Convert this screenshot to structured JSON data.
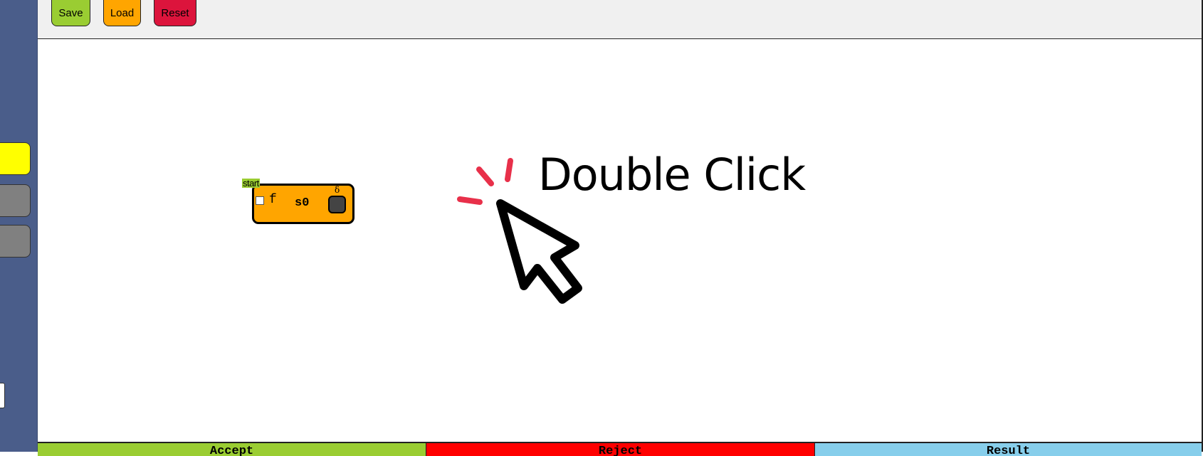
{
  "toolbar": {
    "save_label": "Save",
    "load_label": "Load",
    "reset_label": "Reset"
  },
  "canvas": {
    "hint_text": "Double Click",
    "hint_icon": "double-click-cursor-icon"
  },
  "state": {
    "start_label": "start",
    "final_label": "f",
    "name": "s0",
    "delta_label": "δ",
    "fill_color": "#ffa500"
  },
  "sidebar": {
    "tools": [
      {
        "color": "#ffff00",
        "selected": true
      },
      {
        "color": "#808080",
        "selected": false
      },
      {
        "color": "#808080",
        "selected": false
      }
    ]
  },
  "footer": {
    "accept_label": "Accept",
    "reject_label": "Reject",
    "result_label": "Result",
    "accept_color": "#9acd32",
    "reject_color": "#ff0000",
    "result_color": "#87ceeb"
  },
  "colors": {
    "sidebar": "#4a5d8a",
    "toolbar": "#f0f0f0",
    "save": "#9acd32",
    "load": "#ffa500",
    "reset": "#dc143c",
    "click_sparks": "#e8304a"
  }
}
